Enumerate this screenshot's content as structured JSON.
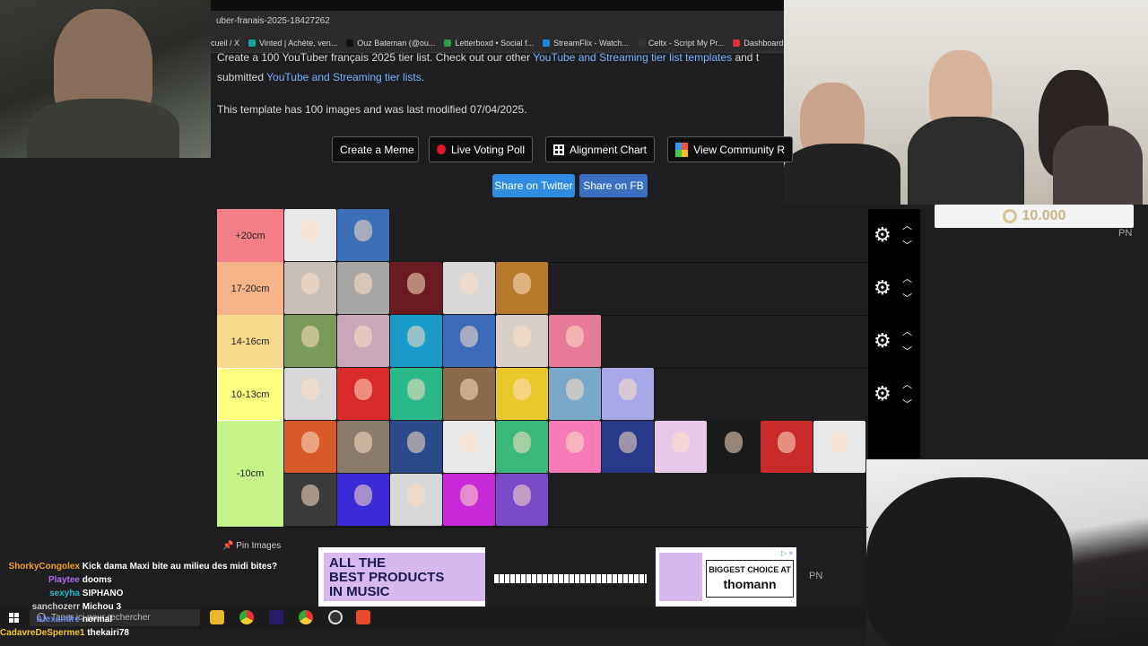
{
  "browser": {
    "url_fragment": "uber-franais-2025-18427262",
    "bookmarks": [
      {
        "label": "cueil / X",
        "color": "#555"
      },
      {
        "label": "Vinted | Achète, ven...",
        "color": "#1aa5a5"
      },
      {
        "label": "Ouz Bateman (@ou...",
        "color": "#111"
      },
      {
        "label": "Letterboxd • Social f...",
        "color": "#2a9d4a"
      },
      {
        "label": "StreamFlix - Watch...",
        "color": "#1e88e5"
      },
      {
        "label": "Celtx - Script My Pr...",
        "color": "#333"
      },
      {
        "label": "Dashboard - Leetify",
        "color": "#d33"
      }
    ]
  },
  "intro": {
    "line1_a": "Create a 100 YouTuber français 2025 tier list. Check out our other ",
    "line1_link": "YouTube and Streaming tier list templates",
    "line1_b": " and t",
    "line2_a": "submitted ",
    "line2_link": "YouTube and Streaming tier lists",
    "line2_b": ".",
    "template_info": "This template has 100 images and was last modified 07/04/2025."
  },
  "buttons": {
    "create_meme": "Create a Meme",
    "live_voting": "Live Voting Poll",
    "alignment": "Alignment Chart",
    "community": "View Community R",
    "share_twitter": "Share on Twitter",
    "share_fb": "Share on FB"
  },
  "tiers": [
    {
      "label": "+20cm",
      "color": "#f47f88",
      "tiles": [
        "#e8e8e8",
        "#3d6fb8"
      ]
    },
    {
      "label": "17-20cm",
      "color": "#f4b488",
      "tiles": [
        "#c8c0b8",
        "#a8a6a4",
        "#6b1c22",
        "#d8d8d8",
        "#b87a2a"
      ]
    },
    {
      "label": "14-16cm",
      "color": "#f8d88a",
      "tiles": [
        "#7a9a5a",
        "#c8a8b8",
        "#1a9ac8",
        "#3a6ab8",
        "#d8d0c8",
        "#e87a9a"
      ]
    },
    {
      "label": "10-13cm",
      "color": "#ffff80",
      "tiles": [
        "#d8d8d8",
        "#d82a2a",
        "#2ab88a",
        "#8a6a4a",
        "#e8c82a",
        "#7aa8c8",
        "#a8a8e8"
      ]
    },
    {
      "label": "-10cm",
      "color": "#c6f488",
      "tiles": [
        "#d85a2a",
        "#8a7a6a",
        "#2a4a8a",
        "#e8e8e8",
        "#3ab87a",
        "#f87ab8",
        "#2a3a8a",
        "#e8c8e8",
        "#1a1a1a",
        "#c82a2a",
        "#e8e8e8",
        "#3a3a3a",
        "#3a2ad8",
        "#d8d8d8",
        "#c82ad8",
        "#7a4ac8"
      ]
    }
  ],
  "overlay": {
    "donation_amount": "10.000",
    "pn_label_1": "PN",
    "pn_label_2": "PN",
    "pin_images": "Pin Images"
  },
  "ad": {
    "headline_1": "ALL THE",
    "headline_2": "BEST PRODUCTS",
    "headline_3": "IN MUSIC",
    "right_line_1": "BIGGEST CHOICE AT",
    "right_line_2": "thomann"
  },
  "taskbar": {
    "search_placeholder": "Taper ici pour rechercher"
  },
  "chat": [
    {
      "user": "ShorkyCongolex",
      "color": "#f0a02a",
      "text": "Kick dama Maxi bite au milieu des midi bites?"
    },
    {
      "user": "Playtee",
      "color": "#b06af0",
      "text": "dooms"
    },
    {
      "user": "sexyha",
      "color": "#2ab8c8",
      "text": "SIPHANO"
    },
    {
      "user": "sanchozerr",
      "color": "#cccccc",
      "text": "Michou 3"
    },
    {
      "user": "Alexandre",
      "color": "#6a8af0",
      "text": "normal"
    },
    {
      "user": "CadavreDeSperme1",
      "color": "#f0c82a",
      "text": "thekairi78"
    }
  ]
}
